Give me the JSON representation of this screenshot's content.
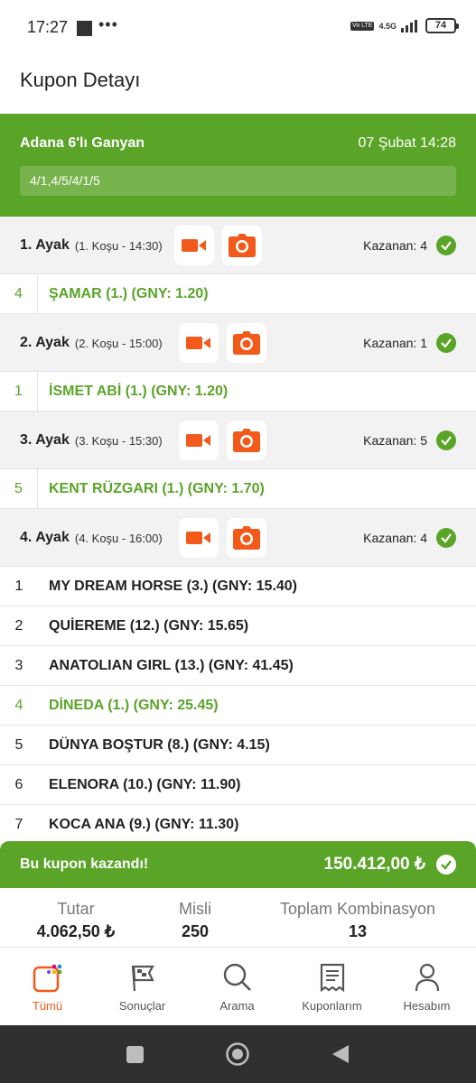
{
  "status_bar": {
    "time": "17:27",
    "dots": "•••",
    "network": "4.5G",
    "volte": "Vo LTE",
    "battery": "74"
  },
  "page": {
    "title": "Kupon Detayı"
  },
  "coupon": {
    "race": "Adana 6'lı Ganyan",
    "date": "07 Şubat 14:28",
    "selection": "4/1,4/5/4/1/5"
  },
  "legs": [
    {
      "name": "1. Ayak",
      "race_info": "(1. Koşu - 14:30)",
      "winner": "Kazanan: 4",
      "horses": [
        {
          "num": "4",
          "name": "ŞAMAR (1.) (GNY: 1.20)",
          "won": true
        }
      ]
    },
    {
      "name": "2. Ayak",
      "race_info": "(2. Koşu - 15:00)",
      "winner": "Kazanan: 1",
      "horses": [
        {
          "num": "1",
          "name": "İSMET ABİ (1.) (GNY: 1.20)",
          "won": true
        }
      ]
    },
    {
      "name": "3. Ayak",
      "race_info": "(3. Koşu - 15:30)",
      "winner": "Kazanan: 5",
      "horses": [
        {
          "num": "5",
          "name": "KENT RÜZGARI (1.) (GNY: 1.70)",
          "won": true
        }
      ]
    },
    {
      "name": "4. Ayak",
      "race_info": "(4. Koşu - 16:00)",
      "winner": "Kazanan: 4",
      "horses": [
        {
          "num": "1",
          "name": "MY DREAM HORSE (3.) (GNY: 15.40)",
          "won": false
        },
        {
          "num": "2",
          "name": "QUİEREME (12.) (GNY: 15.65)",
          "won": false
        },
        {
          "num": "3",
          "name": "ANATOLIAN GIRL (13.) (GNY: 41.45)",
          "won": false
        },
        {
          "num": "4",
          "name": "DİNEDA (1.) (GNY: 25.45)",
          "won": true
        },
        {
          "num": "5",
          "name": "DÜNYA BOŞTUR (8.) (GNY: 4.15)",
          "won": false
        },
        {
          "num": "6",
          "name": "ELENORA (10.) (GNY: 11.90)",
          "won": false
        },
        {
          "num": "7",
          "name": "KOCA ANA (9.) (GNY: 11.30)",
          "won": false
        }
      ]
    }
  ],
  "result": {
    "text": "Bu kupon kazandı!",
    "amount": "150.412,00 ₺"
  },
  "summary": {
    "amount_label": "Tutar",
    "amount_value": "4.062,50 ₺",
    "multiplier_label": "Misli",
    "multiplier_value": "250",
    "combinations_label": "Toplam Kombinasyon",
    "combinations_value": "13"
  },
  "nav": [
    {
      "label": "Tümü",
      "icon": "all-icon",
      "active": true
    },
    {
      "label": "Sonuçlar",
      "icon": "flag-icon",
      "active": false
    },
    {
      "label": "Arama",
      "icon": "search-icon",
      "active": false
    },
    {
      "label": "Kuponlarım",
      "icon": "receipt-icon",
      "active": false
    },
    {
      "label": "Hesabım",
      "icon": "user-icon",
      "active": false
    }
  ],
  "colors": {
    "brand_green": "#5aa428",
    "accent_orange": "#f25a1b"
  }
}
